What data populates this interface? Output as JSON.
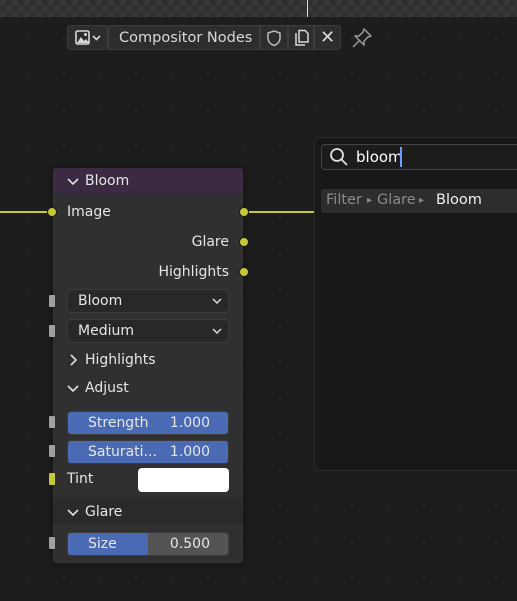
{
  "header": {
    "editor_type_icon": "image-editor-icon",
    "node_tree_name": "Compositor Nodes"
  },
  "node": {
    "title": "Bloom",
    "input_image": "Image",
    "output_glare": "Glare",
    "output_highlights": "Highlights",
    "glare_type": "Bloom",
    "quality": "Medium",
    "panels": {
      "highlights": "Highlights",
      "adjust": "Adjust",
      "glare": "Glare"
    },
    "strength": {
      "label": "Strength",
      "value": "1.000"
    },
    "saturation": {
      "label": "Saturati...",
      "value": "1.000"
    },
    "tint": {
      "label": "Tint",
      "color": "#ffffff"
    },
    "size": {
      "label": "Size",
      "value": "0.500",
      "fraction": 0.5
    }
  },
  "search": {
    "query": "bloom",
    "result": {
      "path": [
        "Filter",
        "Glare"
      ],
      "name": "Bloom"
    }
  },
  "colors": {
    "node_header": "#3a2b42",
    "socket_yellow": "#c7c73a",
    "slider_blue": "#4a6bb3"
  }
}
